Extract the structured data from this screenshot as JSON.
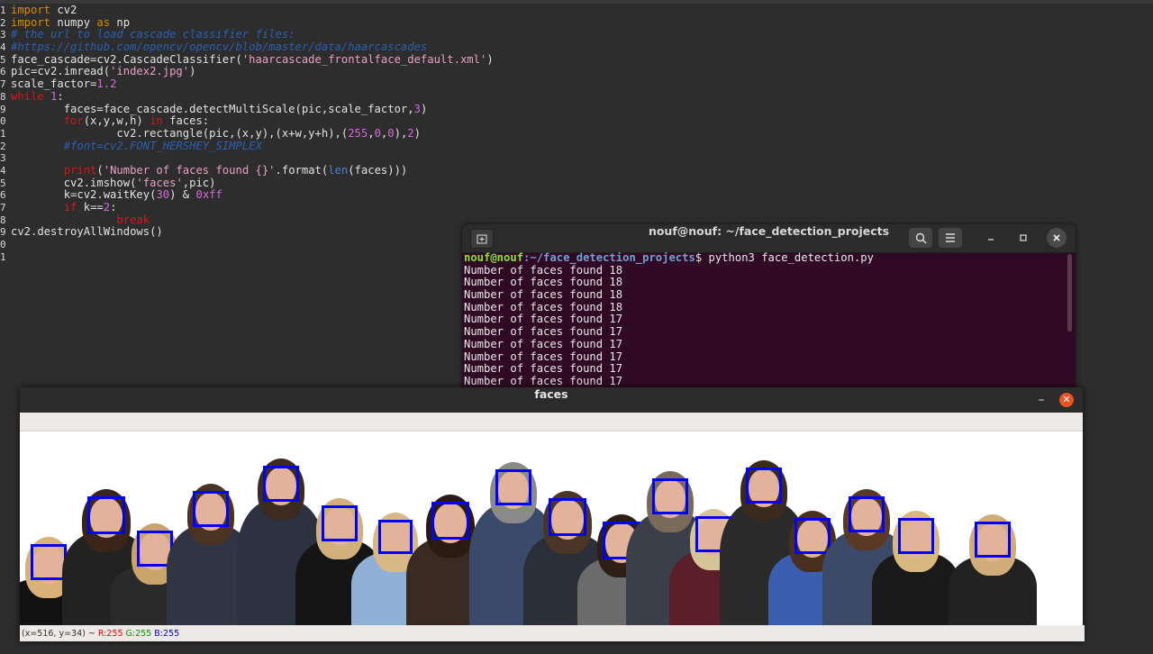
{
  "editor": {
    "line_numbers": [
      "1",
      "2",
      "3",
      "4",
      "5",
      "6",
      "7",
      "8",
      "9",
      "0",
      "1",
      "2",
      "3",
      "4",
      "5",
      "6",
      "7",
      "8",
      "9",
      "0",
      "1"
    ],
    "lines": [
      [
        {
          "t": "import",
          "c": "kw"
        },
        {
          "t": " cv2",
          "c": ""
        }
      ],
      [
        {
          "t": "import",
          "c": "kw"
        },
        {
          "t": " numpy ",
          "c": ""
        },
        {
          "t": "as",
          "c": "kw"
        },
        {
          "t": " np",
          "c": ""
        }
      ],
      [
        {
          "t": "# the url to load cascade classifier files:",
          "c": "cmt"
        }
      ],
      [
        {
          "t": "#https://github.com/opencv/opencv/blob/master/data/haarcascades",
          "c": "cmt"
        }
      ],
      [
        {
          "t": "face_cascade=cv2.CascadeClassifier(",
          "c": ""
        },
        {
          "t": "'haarcascade_frontalface_default.xml'",
          "c": "str"
        },
        {
          "t": ")",
          "c": ""
        }
      ],
      [
        {
          "t": "pic=cv2.imread(",
          "c": ""
        },
        {
          "t": "'index2.jpg'",
          "c": "str"
        },
        {
          "t": ")",
          "c": ""
        }
      ],
      [
        {
          "t": "scale_factor=",
          "c": ""
        },
        {
          "t": "1.2",
          "c": "num"
        }
      ],
      [
        {
          "t": "while",
          "c": "ctl"
        },
        {
          "t": " ",
          "c": ""
        },
        {
          "t": "1",
          "c": "num"
        },
        {
          "t": ":",
          "c": ""
        }
      ],
      [
        {
          "t": "        faces=face_cascade.detectMultiScale(pic,scale_factor,",
          "c": ""
        },
        {
          "t": "3",
          "c": "num"
        },
        {
          "t": ")",
          "c": ""
        }
      ],
      [
        {
          "t": "        ",
          "c": ""
        },
        {
          "t": "for",
          "c": "ctl"
        },
        {
          "t": "(x,y,w,h) ",
          "c": ""
        },
        {
          "t": "in",
          "c": "ctl"
        },
        {
          "t": " faces:",
          "c": ""
        }
      ],
      [
        {
          "t": "                cv2.rectangle(pic,(x,y),(x+w,y+h),(",
          "c": ""
        },
        {
          "t": "255",
          "c": "num"
        },
        {
          "t": ",",
          "c": ""
        },
        {
          "t": "0",
          "c": "num"
        },
        {
          "t": ",",
          "c": ""
        },
        {
          "t": "0",
          "c": "num"
        },
        {
          "t": "),",
          "c": ""
        },
        {
          "t": "2",
          "c": "num"
        },
        {
          "t": ")",
          "c": ""
        }
      ],
      [
        {
          "t": "        #font=cv2.FONT_HERSHEY_SIMPLEX",
          "c": "cmt"
        }
      ],
      [
        {
          "t": "",
          "c": ""
        }
      ],
      [
        {
          "t": "        ",
          "c": ""
        },
        {
          "t": "print",
          "c": "ctl"
        },
        {
          "t": "(",
          "c": ""
        },
        {
          "t": "'Number of faces found {}'",
          "c": "str"
        },
        {
          "t": ".format(",
          "c": ""
        },
        {
          "t": "len",
          "c": "bi"
        },
        {
          "t": "(faces)))",
          "c": ""
        }
      ],
      [
        {
          "t": "        cv2.imshow(",
          "c": ""
        },
        {
          "t": "'faces'",
          "c": "str"
        },
        {
          "t": ",pic)",
          "c": ""
        }
      ],
      [
        {
          "t": "        k=cv2.waitKey(",
          "c": ""
        },
        {
          "t": "30",
          "c": "num"
        },
        {
          "t": ") & ",
          "c": ""
        },
        {
          "t": "0xff",
          "c": "num"
        }
      ],
      [
        {
          "t": "        ",
          "c": ""
        },
        {
          "t": "if",
          "c": "ctl"
        },
        {
          "t": " k==",
          "c": ""
        },
        {
          "t": "2",
          "c": "num"
        },
        {
          "t": ":",
          "c": ""
        }
      ],
      [
        {
          "t": "                ",
          "c": ""
        },
        {
          "t": "break",
          "c": "ctl"
        }
      ],
      [
        {
          "t": "cv2.destroyAllWindows()",
          "c": ""
        }
      ],
      [
        {
          "t": "",
          "c": ""
        }
      ],
      [
        {
          "t": "",
          "c": ""
        }
      ]
    ]
  },
  "terminal": {
    "title": "nouf@nouf: ~/face_detection_projects",
    "prompt_user": "nouf@nouf",
    "prompt_path": ":~/face_detection_projects",
    "prompt_cmd": "$ python3 face_detection.py",
    "output": [
      "Number of faces found 18",
      "Number of faces found 18",
      "Number of faces found 18",
      "Number of faces found 18",
      "Number of faces found 17",
      "Number of faces found 17",
      "Number of faces found 17",
      "Number of faces found 17",
      "Number of faces found 17",
      "Number of faces found 17"
    ],
    "icons": {
      "new_tab": "new-tab-icon",
      "search": "search-icon",
      "menu": "hamburger-menu-icon",
      "minimize": "minimize-icon",
      "maximize": "maximize-icon",
      "close": "close-icon"
    }
  },
  "faces_window": {
    "title": "faces",
    "status_prefix": "(x=516, y=34) ~ ",
    "status_r": "R:255",
    "status_g": "G:255",
    "status_b": "B:255",
    "box_color": "#0000ff"
  },
  "people": [
    {
      "shirt": "#111111",
      "hair": "#d9b27a"
    },
    {
      "shirt": "#222222",
      "hair": "#3b2418"
    },
    {
      "shirt": "#2a2a2a",
      "hair": "#c9a46a"
    },
    {
      "shirt": "#2f3545",
      "hair": "#4a3322"
    },
    {
      "shirt": "#2c3240",
      "hair": "#3a2a20"
    },
    {
      "shirt": "#151515",
      "hair": "#d2b07c"
    },
    {
      "shirt": "#8fb1d6",
      "hair": "#d8b887"
    },
    {
      "shirt": "#3a2b22",
      "hair": "#2a1a12"
    },
    {
      "shirt": "#3a4a6a",
      "hair": "#8a8a8a"
    },
    {
      "shirt": "#2a2f3a",
      "hair": "#4a3526"
    },
    {
      "shirt": "#6b6b6b",
      "hair": "#2e1f16"
    },
    {
      "shirt": "#3a3f4a",
      "hair": "#7a6a5a"
    },
    {
      "shirt": "#5a1f28",
      "hair": "#d7c39a"
    },
    {
      "shirt": "#2a2a2a",
      "hair": "#3a2a1e"
    },
    {
      "shirt": "#3a5fb0",
      "hair": "#4a3020"
    },
    {
      "shirt": "#3b4a66",
      "hair": "#5a3a24"
    },
    {
      "shirt": "#1a1a1a",
      "hair": "#d9b880"
    },
    {
      "shirt": "#222222",
      "hair": "#d0ad78"
    }
  ]
}
